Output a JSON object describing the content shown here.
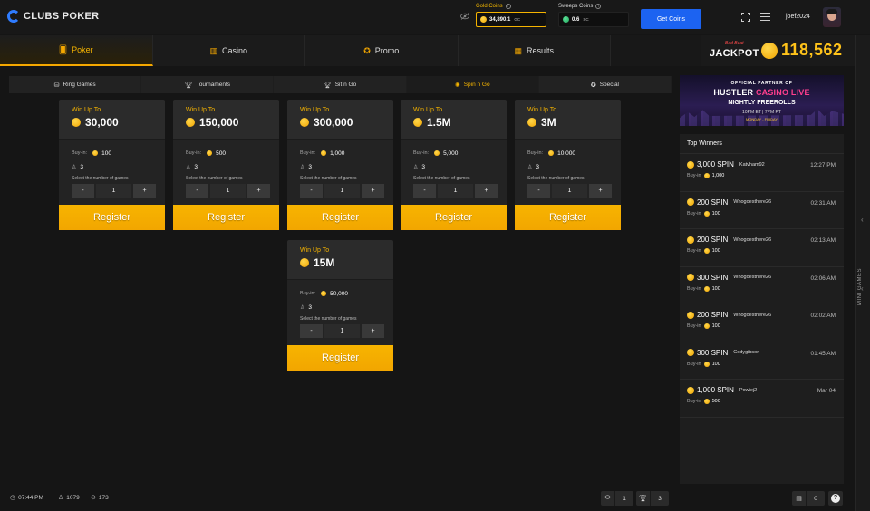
{
  "brand": {
    "name": "CLUBS POKER"
  },
  "wallet": {
    "gold_label": "Gold Coins",
    "gold_value": "34,890.1",
    "gold_unit": "GC",
    "sweeps_label": "Sweeps Coins",
    "sweeps_value": "0.6",
    "sweeps_unit": "SC",
    "get_coins": "Get Coins"
  },
  "user": {
    "name": "joef2024"
  },
  "nav": {
    "tabs": [
      {
        "label": "Poker",
        "icon": "cards-icon"
      },
      {
        "label": "Casino",
        "icon": "slots-icon"
      },
      {
        "label": "Promo",
        "icon": "medal-icon"
      },
      {
        "label": "Results",
        "icon": "bar-chart-icon"
      }
    ]
  },
  "jackpot": {
    "badge": "Bad Beat",
    "label": "JACKPOT",
    "value": "118,562"
  },
  "subtabs": [
    {
      "label": "Ring Games",
      "icon": "chips-icon"
    },
    {
      "label": "Tournaments",
      "icon": "trophy-icon"
    },
    {
      "label": "Sit n Go",
      "icon": "trophy-icon"
    },
    {
      "label": "Spin n Go",
      "icon": "spin-icon"
    },
    {
      "label": "Special",
      "icon": "star-icon"
    }
  ],
  "cards_common": {
    "win_label": "Win Up To",
    "buyin_label": "Buy-in:",
    "select_label": "Select the number of games",
    "minus": "-",
    "plus": "+",
    "register": "Register"
  },
  "cards": [
    {
      "win": "30,000",
      "buyin": "100",
      "players": "3",
      "qty": "1"
    },
    {
      "win": "150,000",
      "buyin": "500",
      "players": "3",
      "qty": "1"
    },
    {
      "win": "300,000",
      "buyin": "1,000",
      "players": "3",
      "qty": "1"
    },
    {
      "win": "1.5M",
      "buyin": "5,000",
      "players": "3",
      "qty": "1"
    },
    {
      "win": "3M",
      "buyin": "10,000",
      "players": "3",
      "qty": "1"
    },
    {
      "win": "15M",
      "buyin": "50,000",
      "players": "3",
      "qty": "1"
    }
  ],
  "banner": {
    "line1": "OFFICIAL PARTNER OF",
    "line2a": "HUSTLER",
    "line2b": "CASINO LIVE",
    "line3": "NIGHTLY FREEROLLS",
    "line4": "10PM ET | 7PM PT",
    "line5": "MONDAY - FRIDAY"
  },
  "winners": {
    "title": "Top Winners",
    "buyin_label": "Buy-in",
    "items": [
      {
        "amount": "3,000 SPIN",
        "name": "Katvham92",
        "time": "12:27 PM",
        "buyin": "1,000"
      },
      {
        "amount": "200 SPIN",
        "name": "Whogoesthere26",
        "time": "02:31 AM",
        "buyin": "100"
      },
      {
        "amount": "200 SPIN",
        "name": "Whogoesthere26",
        "time": "02:13 AM",
        "buyin": "100"
      },
      {
        "amount": "300 SPIN",
        "name": "Whogoesthere26",
        "time": "02:06 AM",
        "buyin": "100"
      },
      {
        "amount": "200 SPIN",
        "name": "Whogoesthere26",
        "time": "02:02 AM",
        "buyin": "100"
      },
      {
        "amount": "300 SPIN",
        "name": "Codygibson",
        "time": "01:45 AM",
        "buyin": "100"
      },
      {
        "amount": "1,000 SPIN",
        "name": "Powiej2",
        "time": "Mar 04",
        "buyin": "500"
      }
    ]
  },
  "side": {
    "label": "MINI GAMES"
  },
  "footer": {
    "time": "07:44 PM",
    "players": "1079",
    "tables": "173",
    "tables_open": "1",
    "tournaments_open": "3",
    "messages": "0"
  }
}
